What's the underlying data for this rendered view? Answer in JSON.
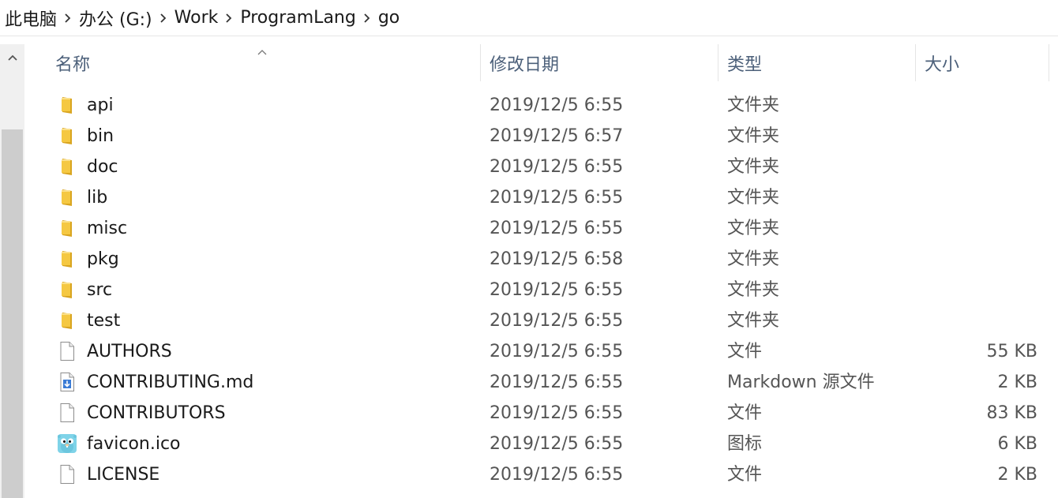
{
  "breadcrumb": {
    "items": [
      "此电脑",
      "办公 (G:)",
      "Work",
      "ProgramLang",
      "go"
    ]
  },
  "columns": {
    "name": "名称",
    "date": "修改日期",
    "type": "类型",
    "size": "大小"
  },
  "files": [
    {
      "name": "api",
      "date": "2019/12/5 6:55",
      "type": "文件夹",
      "size": "",
      "icon": "folder-icon"
    },
    {
      "name": "bin",
      "date": "2019/12/5 6:57",
      "type": "文件夹",
      "size": "",
      "icon": "folder-icon"
    },
    {
      "name": "doc",
      "date": "2019/12/5 6:55",
      "type": "文件夹",
      "size": "",
      "icon": "folder-icon"
    },
    {
      "name": "lib",
      "date": "2019/12/5 6:55",
      "type": "文件夹",
      "size": "",
      "icon": "folder-icon"
    },
    {
      "name": "misc",
      "date": "2019/12/5 6:55",
      "type": "文件夹",
      "size": "",
      "icon": "folder-icon"
    },
    {
      "name": "pkg",
      "date": "2019/12/5 6:58",
      "type": "文件夹",
      "size": "",
      "icon": "folder-icon"
    },
    {
      "name": "src",
      "date": "2019/12/5 6:55",
      "type": "文件夹",
      "size": "",
      "icon": "folder-icon"
    },
    {
      "name": "test",
      "date": "2019/12/5 6:55",
      "type": "文件夹",
      "size": "",
      "icon": "folder-icon"
    },
    {
      "name": "AUTHORS",
      "date": "2019/12/5 6:55",
      "type": "文件",
      "size": "55 KB",
      "icon": "file-icon"
    },
    {
      "name": "CONTRIBUTING.md",
      "date": "2019/12/5 6:55",
      "type": "Markdown 源文件",
      "size": "2 KB",
      "icon": "markdown-file-icon"
    },
    {
      "name": "CONTRIBUTORS",
      "date": "2019/12/5 6:55",
      "type": "文件",
      "size": "83 KB",
      "icon": "file-icon"
    },
    {
      "name": "favicon.ico",
      "date": "2019/12/5 6:55",
      "type": "图标",
      "size": "6 KB",
      "icon": "gopher-icon"
    },
    {
      "name": "LICENSE",
      "date": "2019/12/5 6:55",
      "type": "文件",
      "size": "2 KB",
      "icon": "file-icon"
    }
  ],
  "colors": {
    "folder": "#f5c842",
    "header_text": "#4c607a",
    "scrollbar_track": "#f0f0f0",
    "scrollbar_thumb": "#cdcdcd"
  }
}
